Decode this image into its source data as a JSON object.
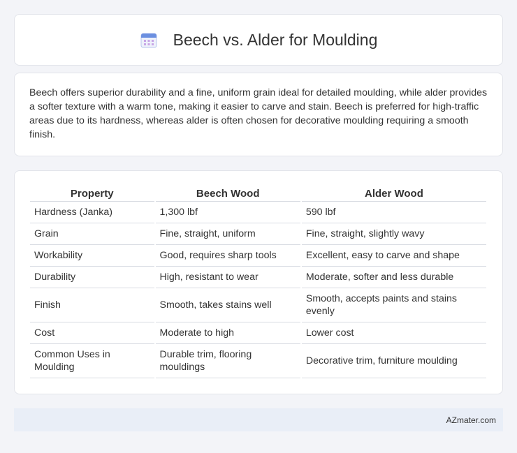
{
  "header": {
    "title": "Beech vs. Alder for Moulding",
    "icon": "calendar-icon"
  },
  "description": "Beech offers superior durability and a fine, uniform grain ideal for detailed moulding, while alder provides a softer texture with a warm tone, making it easier to carve and stain. Beech is preferred for high-traffic areas due to its hardness, whereas alder is often chosen for decorative moulding requiring a smooth finish.",
  "table": {
    "headers": [
      "Property",
      "Beech Wood",
      "Alder Wood"
    ],
    "rows": [
      [
        "Hardness (Janka)",
        "1,300 lbf",
        "590 lbf"
      ],
      [
        "Grain",
        "Fine, straight, uniform",
        "Fine, straight, slightly wavy"
      ],
      [
        "Workability",
        "Good, requires sharp tools",
        "Excellent, easy to carve and shape"
      ],
      [
        "Durability",
        "High, resistant to wear",
        "Moderate, softer and less durable"
      ],
      [
        "Finish",
        "Smooth, takes stains well",
        "Smooth, accepts paints and stains evenly"
      ],
      [
        "Cost",
        "Moderate to high",
        "Lower cost"
      ],
      [
        "Common Uses in Moulding",
        "Durable trim, flooring mouldings",
        "Decorative trim, furniture moulding"
      ]
    ]
  },
  "footer": {
    "brand": "AZmater.com"
  },
  "colors": {
    "background": "#f3f4f8",
    "card": "#ffffff",
    "footer": "#e9eef7",
    "icon_accent": "#6b8fe0"
  }
}
